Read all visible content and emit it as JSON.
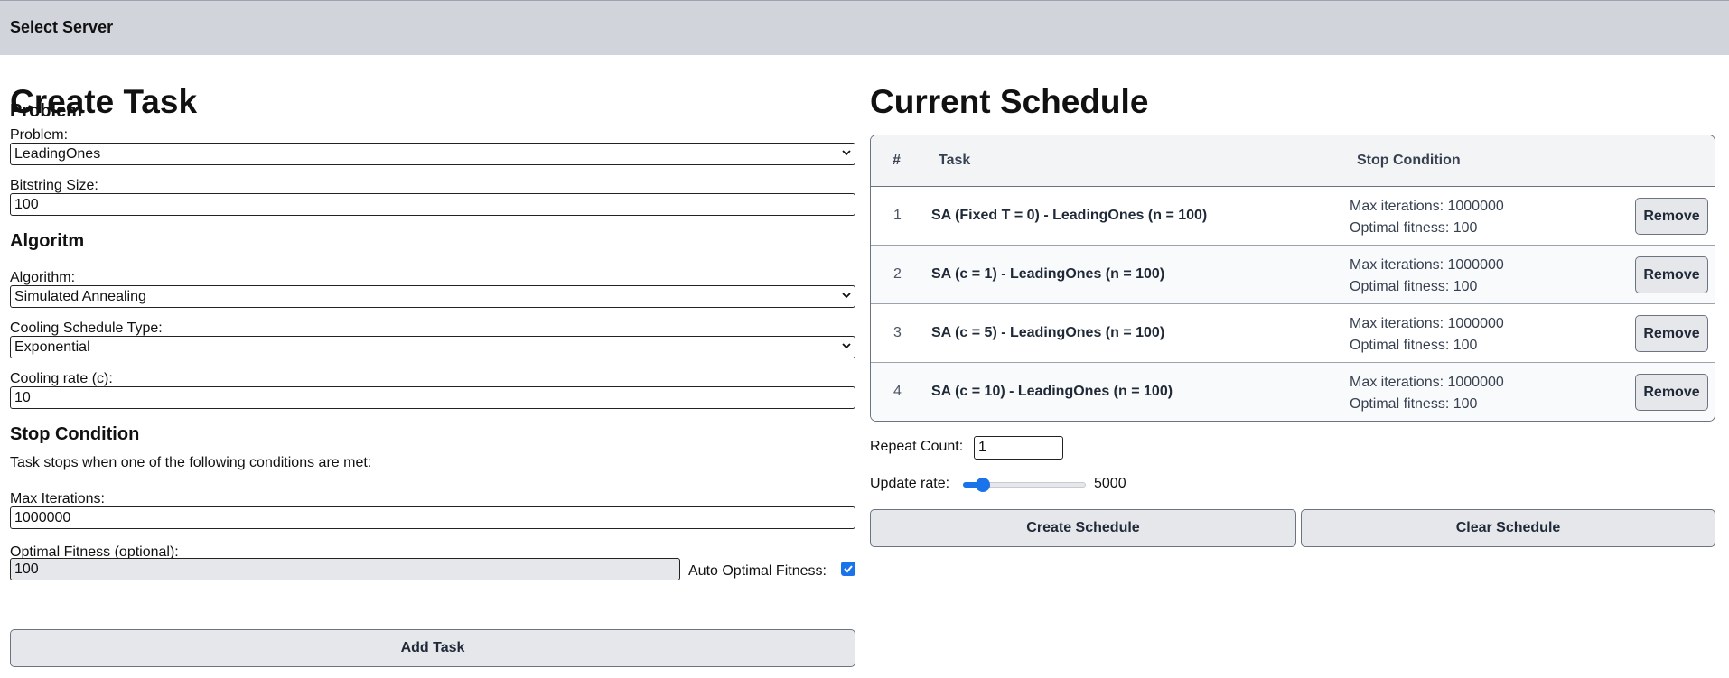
{
  "topbar": {
    "server_label": "Select Server"
  },
  "create_task": {
    "title": "Create Task",
    "problem_section": {
      "heading": "Problem",
      "problem_label": "Problem:",
      "problem_value": "LeadingOnes",
      "bitstring_label": "Bitstring Size:",
      "bitstring_value": "100"
    },
    "algorithm_section": {
      "heading": "Algoritm",
      "algorithm_label": "Algorithm:",
      "algorithm_value": "Simulated Annealing",
      "cooling_type_label": "Cooling Schedule Type:",
      "cooling_type_value": "Exponential",
      "cooling_rate_label": "Cooling rate (c):",
      "cooling_rate_value": "10"
    },
    "stop_section": {
      "heading": "Stop Condition",
      "description": "Task stops when one of the following conditions are met:",
      "max_iter_label": "Max Iterations:",
      "max_iter_value": "1000000",
      "optimal_label": "Optimal Fitness (optional):",
      "optimal_value": "100",
      "auto_optimal_label": "Auto Optimal Fitness:",
      "auto_optimal_checked": true
    },
    "add_task_label": "Add Task"
  },
  "schedule": {
    "title": "Current Schedule",
    "columns": {
      "num": "#",
      "task": "Task",
      "stop": "Stop Condition"
    },
    "rows": [
      {
        "num": "1",
        "task": "SA (Fixed T = 0) - LeadingOnes (n = 100)",
        "max_iter": "Max iterations: 1000000",
        "optimal": "Optimal fitness: 100",
        "remove": "Remove"
      },
      {
        "num": "2",
        "task": "SA (c = 1) - LeadingOnes (n = 100)",
        "max_iter": "Max iterations: 1000000",
        "optimal": "Optimal fitness: 100",
        "remove": "Remove"
      },
      {
        "num": "3",
        "task": "SA (c = 5) - LeadingOnes (n = 100)",
        "max_iter": "Max iterations: 1000000",
        "optimal": "Optimal fitness: 100",
        "remove": "Remove"
      },
      {
        "num": "4",
        "task": "SA (c = 10) - LeadingOnes (n = 100)",
        "max_iter": "Max iterations: 1000000",
        "optimal": "Optimal fitness: 100",
        "remove": "Remove"
      }
    ],
    "repeat_label": "Repeat Count:",
    "repeat_value": "1",
    "update_rate_label": "Update rate:",
    "update_rate_value": "5000",
    "update_rate_fraction": 0.12,
    "create_label": "Create Schedule",
    "clear_label": "Clear Schedule"
  },
  "colors": {
    "accent": "#1a73e8",
    "topbar": "#d1d5db",
    "button_bg": "#e5e7eb"
  }
}
